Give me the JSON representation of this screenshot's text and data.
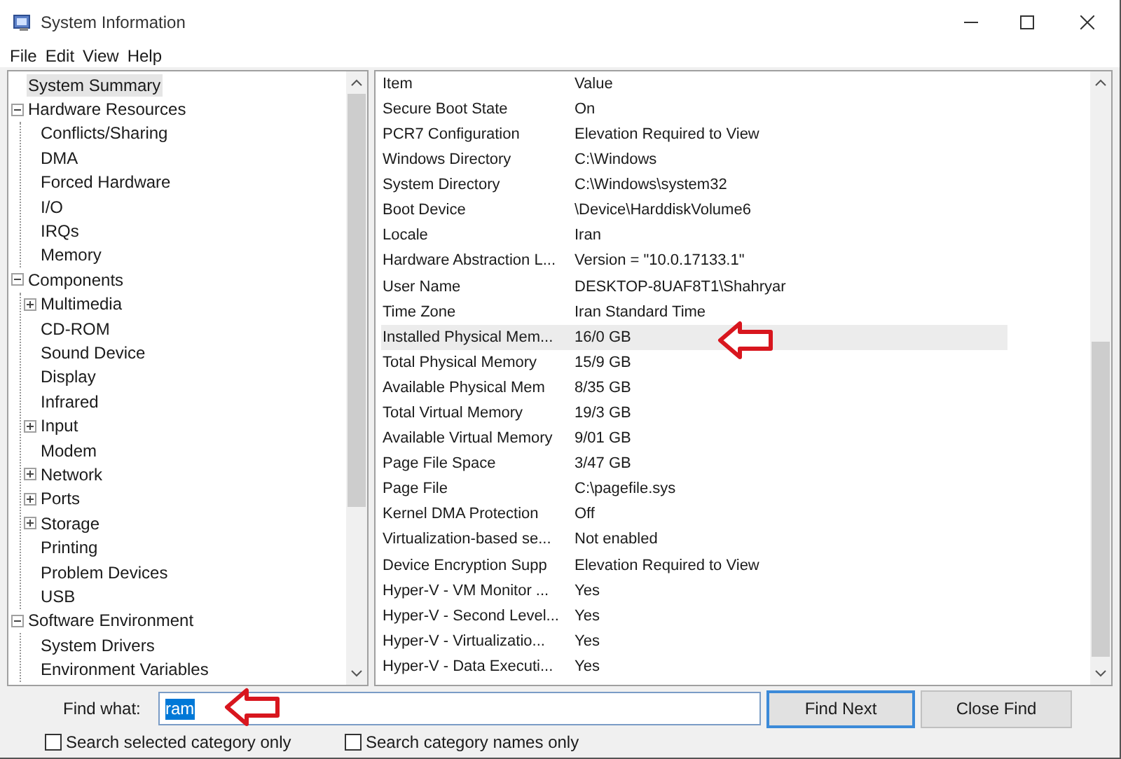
{
  "window": {
    "title": "System Information"
  },
  "menu": [
    "File",
    "Edit",
    "View",
    "Help"
  ],
  "tree": [
    {
      "label": "System Summary",
      "selected": true
    },
    {
      "label": "Hardware Resources",
      "selected": false,
      "expanded": true,
      "children": [
        {
          "label": "Conflicts/Sharing",
          "selected": false
        },
        {
          "label": "DMA",
          "selected": false
        },
        {
          "label": "Forced Hardware",
          "selected": false
        },
        {
          "label": "I/O",
          "selected": false
        },
        {
          "label": "IRQs",
          "selected": false
        },
        {
          "label": "Memory",
          "selected": false
        }
      ]
    },
    {
      "label": "Components",
      "selected": false,
      "expanded": true,
      "children": [
        {
          "label": "Multimedia",
          "selected": false,
          "expanded": false
        },
        {
          "label": "CD-ROM",
          "selected": false
        },
        {
          "label": "Sound Device",
          "selected": false
        },
        {
          "label": "Display",
          "selected": false
        },
        {
          "label": "Infrared",
          "selected": false
        },
        {
          "label": "Input",
          "selected": false,
          "expanded": false
        },
        {
          "label": "Modem",
          "selected": false
        },
        {
          "label": "Network",
          "selected": false,
          "expanded": false
        },
        {
          "label": "Ports",
          "selected": false,
          "expanded": false
        },
        {
          "label": "Storage",
          "selected": false,
          "expanded": false
        },
        {
          "label": "Printing",
          "selected": false
        },
        {
          "label": "Problem Devices",
          "selected": false
        },
        {
          "label": "USB",
          "selected": false
        }
      ]
    },
    {
      "label": "Software Environment",
      "selected": false,
      "expanded": true,
      "children": [
        {
          "label": "System Drivers",
          "selected": false
        },
        {
          "label": "Environment Variables",
          "selected": false
        }
      ]
    }
  ],
  "table": {
    "columns": [
      "Item",
      "Value"
    ],
    "rows": [
      {
        "item": "Secure Boot State",
        "value": "On",
        "selected": false
      },
      {
        "item": "PCR7 Configuration",
        "value": "Elevation Required to View",
        "selected": false
      },
      {
        "item": "Windows Directory",
        "value": "C:\\Windows",
        "selected": false
      },
      {
        "item": "System Directory",
        "value": "C:\\Windows\\system32",
        "selected": false
      },
      {
        "item": "Boot Device",
        "value": "\\Device\\HarddiskVolume6",
        "selected": false
      },
      {
        "item": "Locale",
        "value": "Iran",
        "selected": false
      },
      {
        "item": "Hardware Abstraction L...",
        "value": "Version = \"10.0.17133.1\"",
        "selected": false
      },
      {
        "item": "User Name",
        "value": "DESKTOP-8UAF8T1\\Shahryar",
        "selected": false
      },
      {
        "item": "Time Zone",
        "value": "Iran Standard Time",
        "selected": false
      },
      {
        "item": "Installed Physical Mem...",
        "value": "16/0 GB",
        "selected": true
      },
      {
        "item": "Total Physical Memory",
        "value": "15/9 GB",
        "selected": false
      },
      {
        "item": "Available Physical Mem",
        "value": "8/35 GB",
        "selected": false
      },
      {
        "item": "Total Virtual Memory",
        "value": "19/3 GB",
        "selected": false
      },
      {
        "item": "Available Virtual Memory",
        "value": "9/01 GB",
        "selected": false
      },
      {
        "item": "Page File Space",
        "value": "3/47 GB",
        "selected": false
      },
      {
        "item": "Page File",
        "value": "C:\\pagefile.sys",
        "selected": false
      },
      {
        "item": "Kernel DMA Protection",
        "value": "Off",
        "selected": false
      },
      {
        "item": "Virtualization-based se...",
        "value": "Not enabled",
        "selected": false
      },
      {
        "item": "Device Encryption Supp",
        "value": "Elevation Required to View",
        "selected": false
      },
      {
        "item": "Hyper-V - VM Monitor ...",
        "value": "Yes",
        "selected": false
      },
      {
        "item": "Hyper-V - Second Level...",
        "value": "Yes",
        "selected": false
      },
      {
        "item": "Hyper-V - Virtualizatio...",
        "value": "Yes",
        "selected": false
      },
      {
        "item": "Hyper-V - Data Executi...",
        "value": "Yes",
        "selected": false
      }
    ]
  },
  "find": {
    "label": "Find what:",
    "value": "ram",
    "find_next": "Find Next",
    "close_find": "Close Find",
    "options": [
      {
        "label": "Search selected category only",
        "checked": false
      },
      {
        "label": "Search category names only",
        "checked": false
      }
    ]
  }
}
